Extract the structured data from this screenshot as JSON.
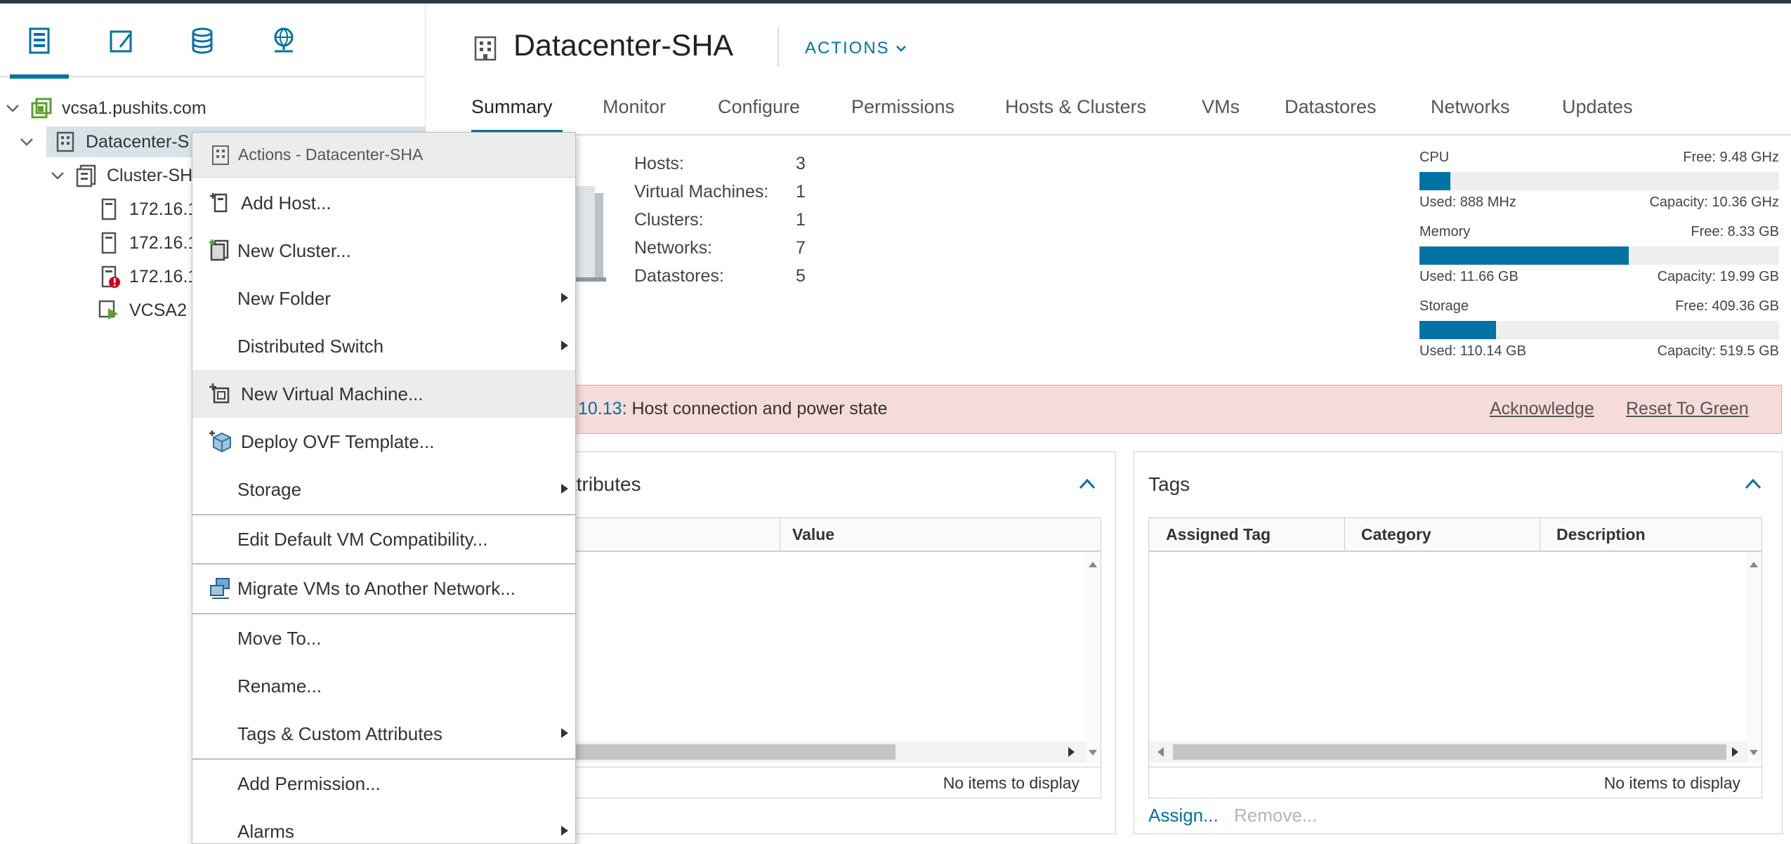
{
  "navigator": {
    "tabs": [
      {
        "name": "hosts-clusters-view",
        "active": true
      },
      {
        "name": "vms-templates-view",
        "active": false
      },
      {
        "name": "storage-view",
        "active": false
      },
      {
        "name": "networking-view",
        "active": false
      }
    ],
    "tree": {
      "vcenter": "vcsa1.pushits.com",
      "datacenter": "Datacenter-S",
      "cluster": "Cluster-SH",
      "host1": "172.16.1(",
      "host2": "172.16.1(",
      "host3": "172.16.1(",
      "vm": "VCSA2"
    }
  },
  "header": {
    "title": "Datacenter-SHA",
    "actions_label": "ACTIONS"
  },
  "tabs": [
    "Summary",
    "Monitor",
    "Configure",
    "Permissions",
    "Hosts & Clusters",
    "VMs",
    "Datastores",
    "Networks",
    "Updates"
  ],
  "active_tab": "Summary",
  "summary": {
    "stats": [
      {
        "label": "Hosts:",
        "value": "3"
      },
      {
        "label": "Virtual Machines:",
        "value": "1"
      },
      {
        "label": "Clusters:",
        "value": "1"
      },
      {
        "label": "Networks:",
        "value": "7"
      },
      {
        "label": "Datastores:",
        "value": "5"
      }
    ],
    "resources": [
      {
        "name": "CPU",
        "free": "Free: 9.48 GHz",
        "used": "Used: 888 MHz",
        "capacity": "Capacity: 10.36 GHz",
        "used_fraction": 0.086
      },
      {
        "name": "Memory",
        "free": "Free: 8.33 GB",
        "used": "Used: 11.66 GB",
        "capacity": "Capacity: 19.99 GB",
        "used_fraction": 0.583
      },
      {
        "name": "Storage",
        "free": "Free: 409.36 GB",
        "used": "Used: 110.14 GB",
        "capacity": "Capacity: 519.5 GB",
        "used_fraction": 0.212
      }
    ]
  },
  "alert": {
    "link_text": "10.13",
    "message": ": Host connection and power state",
    "acknowledge": "Acknowledge",
    "reset": "Reset To Green"
  },
  "attributes_card": {
    "title": "ttributes",
    "col_value": "Value",
    "empty": "No items to display"
  },
  "tags_card": {
    "title": "Tags",
    "col_tag": "Assigned Tag",
    "col_category": "Category",
    "col_description": "Description",
    "empty": "No items to display",
    "assign": "Assign...",
    "remove": "Remove..."
  },
  "context_menu": {
    "header": "Actions - Datacenter-SHA",
    "items": [
      {
        "label": "Add Host...",
        "icon": "add-host-icon",
        "submenu": false
      },
      {
        "label": "New Cluster...",
        "icon": "new-cluster-icon",
        "submenu": false
      },
      {
        "label": "New Folder",
        "icon": "",
        "submenu": true
      },
      {
        "label": "Distributed Switch",
        "icon": "",
        "submenu": true
      },
      {
        "label": "New Virtual Machine...",
        "icon": "new-vm-icon",
        "submenu": false,
        "hover": true
      },
      {
        "label": "Deploy OVF Template...",
        "icon": "deploy-ovf-icon",
        "submenu": false
      },
      {
        "label": "Storage",
        "icon": "",
        "submenu": true
      },
      {
        "label": "Edit Default VM Compatibility...",
        "icon": "",
        "submenu": false
      },
      {
        "label": "Migrate VMs to Another Network...",
        "icon": "migrate-network-icon",
        "submenu": false
      },
      {
        "label": "Move To...",
        "icon": "",
        "submenu": false
      },
      {
        "label": "Rename...",
        "icon": "",
        "submenu": false
      },
      {
        "label": "Tags & Custom Attributes",
        "icon": "",
        "submenu": true
      },
      {
        "label": "Add Permission...",
        "icon": "",
        "submenu": false
      },
      {
        "label": "Alarms",
        "icon": "",
        "submenu": true
      }
    ]
  },
  "colors": {
    "accent": "#0072a3",
    "alert_bg": "#f5dbd9",
    "selected_row": "#d8e3e9"
  }
}
